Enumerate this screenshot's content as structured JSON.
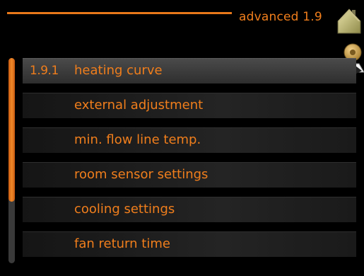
{
  "header": {
    "title": "advanced 1.9",
    "home_icon": "house-icon",
    "dial_icon": "dial-icon"
  },
  "scroll": {
    "fraction_visible": 0.7
  },
  "menu": {
    "items": [
      {
        "number": "1.9.1",
        "label": "heating curve",
        "selected": true
      },
      {
        "number": "",
        "label": "external adjustment",
        "selected": false
      },
      {
        "number": "",
        "label": "min. flow line temp.",
        "selected": false
      },
      {
        "number": "",
        "label": "room sensor settings",
        "selected": false
      },
      {
        "number": "",
        "label": "cooling settings",
        "selected": false
      },
      {
        "number": "",
        "label": "fan return time",
        "selected": false
      }
    ]
  },
  "colors": {
    "accent": "#f07e1c",
    "background": "#000000"
  }
}
